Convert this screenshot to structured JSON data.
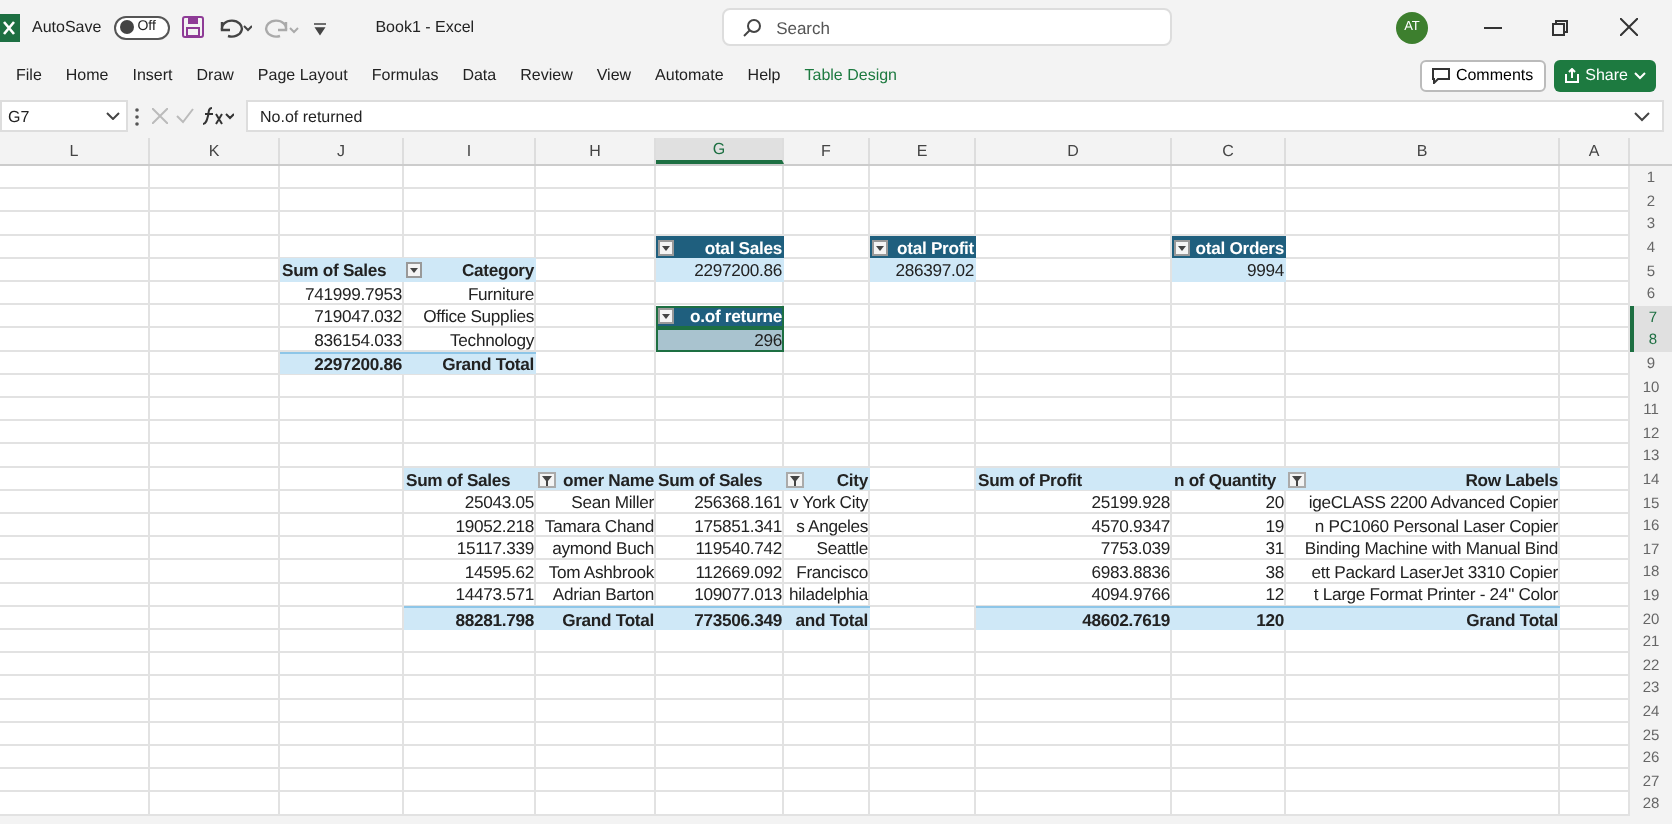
{
  "title_bar": {
    "autosave_label": "AutoSave",
    "autosave_state": "Off",
    "autosave_on": false,
    "document_title": "Book1 - Excel",
    "search": {
      "placeholder": "Search"
    },
    "avatar": "AT"
  },
  "ribbon_tabs": [
    {
      "label": "File",
      "kind": "normal"
    },
    {
      "label": "Home",
      "kind": "normal"
    },
    {
      "label": "Insert",
      "kind": "normal"
    },
    {
      "label": "Draw",
      "kind": "normal"
    },
    {
      "label": "Page Layout",
      "kind": "normal"
    },
    {
      "label": "Formulas",
      "kind": "normal"
    },
    {
      "label": "Data",
      "kind": "normal"
    },
    {
      "label": "Review",
      "kind": "normal"
    },
    {
      "label": "View",
      "kind": "normal"
    },
    {
      "label": "Automate",
      "kind": "normal"
    },
    {
      "label": "Help",
      "kind": "normal"
    },
    {
      "label": "Table Design",
      "kind": "contextual"
    }
  ],
  "ribbon_buttons": {
    "comments": "Comments",
    "share": "Share"
  },
  "formula_bar": {
    "name_box": "G7",
    "formula": "No.of returned"
  },
  "columns": [
    {
      "letter": "L",
      "selected": false
    },
    {
      "letter": "K",
      "selected": false
    },
    {
      "letter": "J",
      "selected": false
    },
    {
      "letter": "I",
      "selected": false
    },
    {
      "letter": "H",
      "selected": false
    },
    {
      "letter": "G",
      "selected": true
    },
    {
      "letter": "F",
      "selected": false
    },
    {
      "letter": "E",
      "selected": false
    },
    {
      "letter": "D",
      "selected": false
    },
    {
      "letter": "C",
      "selected": false
    },
    {
      "letter": "B",
      "selected": false
    },
    {
      "letter": "A",
      "selected": false
    }
  ],
  "rows": [
    {
      "number": "1",
      "selected": false
    },
    {
      "number": "2",
      "selected": false
    },
    {
      "number": "3",
      "selected": false
    },
    {
      "number": "4",
      "selected": false,
      "cells": [
        {
          "kind": "empty"
        },
        {
          "kind": "empty"
        },
        {
          "kind": "empty"
        },
        {
          "kind": "empty"
        },
        {
          "kind": "empty"
        },
        {
          "kind": "card-title",
          "text": "otal Sales",
          "filter": true,
          "sorted": false
        },
        {
          "kind": "empty"
        },
        {
          "kind": "card-title",
          "text": "otal Profit",
          "filter": true,
          "sorted": false
        },
        {
          "kind": "empty"
        },
        {
          "kind": "card-title",
          "text": "otal Orders",
          "filter": true,
          "sorted": false
        },
        {
          "kind": "empty"
        },
        {
          "kind": "empty"
        }
      ]
    },
    {
      "number": "5",
      "selected": false,
      "cells": [
        {
          "kind": "empty"
        },
        {
          "kind": "empty"
        },
        {
          "kind": "pivot-header",
          "text": "Sum of Sales"
        },
        {
          "kind": "pivot-header",
          "text": "Category",
          "filter": true,
          "sorted": false
        },
        {
          "kind": "empty"
        },
        {
          "kind": "card-value",
          "text": "2297200.86"
        },
        {
          "kind": "empty"
        },
        {
          "kind": "card-value",
          "text": "286397.02"
        },
        {
          "kind": "empty"
        },
        {
          "kind": "card-value",
          "text": "9994"
        },
        {
          "kind": "empty"
        },
        {
          "kind": "empty"
        }
      ]
    },
    {
      "number": "6",
      "selected": false,
      "cells": [
        {
          "kind": "empty"
        },
        {
          "kind": "empty"
        },
        {
          "kind": "value",
          "text": "741999.7953"
        },
        {
          "kind": "value",
          "text": "Furniture"
        },
        {
          "kind": "empty"
        },
        {
          "kind": "empty"
        },
        {
          "kind": "empty"
        },
        {
          "kind": "empty"
        },
        {
          "kind": "empty"
        },
        {
          "kind": "empty"
        },
        {
          "kind": "empty"
        },
        {
          "kind": "empty"
        }
      ]
    },
    {
      "number": "7",
      "selected": true,
      "cells": [
        {
          "kind": "empty"
        },
        {
          "kind": "empty"
        },
        {
          "kind": "value",
          "text": "719047.032"
        },
        {
          "kind": "value",
          "text": "Office Supplies"
        },
        {
          "kind": "empty"
        },
        {
          "kind": "card-title",
          "text": "o.of returne",
          "filter": true,
          "sorted": false
        },
        {
          "kind": "empty"
        },
        {
          "kind": "empty"
        },
        {
          "kind": "empty"
        },
        {
          "kind": "empty"
        },
        {
          "kind": "empty"
        },
        {
          "kind": "empty"
        }
      ]
    },
    {
      "number": "8",
      "selected": true,
      "cells": [
        {
          "kind": "empty"
        },
        {
          "kind": "empty"
        },
        {
          "kind": "value",
          "text": "836154.033"
        },
        {
          "kind": "value",
          "text": "Technology"
        },
        {
          "kind": "empty"
        },
        {
          "kind": "card-value",
          "text": "296"
        },
        {
          "kind": "empty"
        },
        {
          "kind": "empty"
        },
        {
          "kind": "empty"
        },
        {
          "kind": "empty"
        },
        {
          "kind": "empty"
        },
        {
          "kind": "empty"
        }
      ]
    },
    {
      "number": "9",
      "selected": false,
      "cells": [
        {
          "kind": "empty"
        },
        {
          "kind": "empty"
        },
        {
          "kind": "total",
          "text": "2297200.86"
        },
        {
          "kind": "total",
          "text": "Grand Total"
        },
        {
          "kind": "empty"
        },
        {
          "kind": "empty"
        },
        {
          "kind": "empty"
        },
        {
          "kind": "empty"
        },
        {
          "kind": "empty"
        },
        {
          "kind": "empty"
        },
        {
          "kind": "empty"
        },
        {
          "kind": "empty"
        }
      ]
    },
    {
      "number": "10",
      "selected": false
    },
    {
      "number": "11",
      "selected": false
    },
    {
      "number": "12",
      "selected": false
    },
    {
      "number": "13",
      "selected": false
    },
    {
      "number": "14",
      "selected": false,
      "cells": [
        {
          "kind": "empty"
        },
        {
          "kind": "empty"
        },
        {
          "kind": "empty"
        },
        {
          "kind": "pivot-header",
          "text": "Sum of Sales"
        },
        {
          "kind": "pivot-header",
          "text": "omer Name",
          "filter": true,
          "sorted": true
        },
        {
          "kind": "pivot-header",
          "text": "Sum of Sales"
        },
        {
          "kind": "pivot-header",
          "text": "City",
          "filter": true,
          "sorted": true
        },
        {
          "kind": "empty"
        },
        {
          "kind": "pivot-header",
          "text": "Sum of Profit"
        },
        {
          "kind": "pivot-header",
          "text": "n of Quantity"
        },
        {
          "kind": "pivot-header",
          "text": "Row Labels",
          "filter": true,
          "sorted": true
        },
        {
          "kind": "empty"
        }
      ]
    },
    {
      "number": "15",
      "selected": false,
      "cells": [
        {
          "kind": "empty"
        },
        {
          "kind": "empty"
        },
        {
          "kind": "empty"
        },
        {
          "kind": "value",
          "text": "25043.05"
        },
        {
          "kind": "value",
          "text": "Sean Miller"
        },
        {
          "kind": "value",
          "text": "256368.161"
        },
        {
          "kind": "value",
          "text": "v York City"
        },
        {
          "kind": "empty"
        },
        {
          "kind": "value",
          "text": "25199.928"
        },
        {
          "kind": "value",
          "text": "20"
        },
        {
          "kind": "value",
          "text": "igeCLASS 2200 Advanced Copier"
        },
        {
          "kind": "empty"
        }
      ]
    },
    {
      "number": "16",
      "selected": false,
      "cells": [
        {
          "kind": "empty"
        },
        {
          "kind": "empty"
        },
        {
          "kind": "empty"
        },
        {
          "kind": "value",
          "text": "19052.218"
        },
        {
          "kind": "value",
          "text": "Tamara Chand"
        },
        {
          "kind": "value",
          "text": "175851.341"
        },
        {
          "kind": "value",
          "text": "s Angeles"
        },
        {
          "kind": "empty"
        },
        {
          "kind": "value",
          "text": "4570.9347"
        },
        {
          "kind": "value",
          "text": "19"
        },
        {
          "kind": "value",
          "text": "n PC1060 Personal Laser Copier"
        },
        {
          "kind": "empty"
        }
      ]
    },
    {
      "number": "17",
      "selected": false,
      "cells": [
        {
          "kind": "empty"
        },
        {
          "kind": "empty"
        },
        {
          "kind": "empty"
        },
        {
          "kind": "value",
          "text": "15117.339"
        },
        {
          "kind": "value",
          "text": "aymond Buch"
        },
        {
          "kind": "value",
          "text": "119540.742"
        },
        {
          "kind": "value",
          "text": "Seattle"
        },
        {
          "kind": "empty"
        },
        {
          "kind": "value",
          "text": "7753.039"
        },
        {
          "kind": "value",
          "text": "31"
        },
        {
          "kind": "value",
          "text": "Binding Machine with Manual Bind"
        },
        {
          "kind": "empty"
        }
      ]
    },
    {
      "number": "18",
      "selected": false,
      "cells": [
        {
          "kind": "empty"
        },
        {
          "kind": "empty"
        },
        {
          "kind": "empty"
        },
        {
          "kind": "value",
          "text": "14595.62"
        },
        {
          "kind": "value",
          "text": "Tom Ashbrook"
        },
        {
          "kind": "value",
          "text": "112669.092"
        },
        {
          "kind": "value",
          "text": "Francisco"
        },
        {
          "kind": "empty"
        },
        {
          "kind": "value",
          "text": "6983.8836"
        },
        {
          "kind": "value",
          "text": "38"
        },
        {
          "kind": "value",
          "text": "ett Packard LaserJet 3310 Copier"
        },
        {
          "kind": "empty"
        }
      ]
    },
    {
      "number": "19",
      "selected": false,
      "cells": [
        {
          "kind": "empty"
        },
        {
          "kind": "empty"
        },
        {
          "kind": "empty"
        },
        {
          "kind": "value",
          "text": "14473.571"
        },
        {
          "kind": "value",
          "text": "Adrian Barton"
        },
        {
          "kind": "value",
          "text": "109077.013"
        },
        {
          "kind": "value",
          "text": "hiladelphia"
        },
        {
          "kind": "empty"
        },
        {
          "kind": "value",
          "text": "4094.9766"
        },
        {
          "kind": "value",
          "text": "12"
        },
        {
          "kind": "value",
          "text": "t Large Format Printer - 24\" Color"
        },
        {
          "kind": "empty"
        }
      ]
    },
    {
      "number": "20",
      "selected": false,
      "cells": [
        {
          "kind": "empty"
        },
        {
          "kind": "empty"
        },
        {
          "kind": "empty"
        },
        {
          "kind": "total",
          "text": "88281.798"
        },
        {
          "kind": "total",
          "text": "Grand Total"
        },
        {
          "kind": "total",
          "text": "773506.349"
        },
        {
          "kind": "total",
          "text": "and Total"
        },
        {
          "kind": "empty"
        },
        {
          "kind": "total",
          "text": "48602.7619"
        },
        {
          "kind": "total",
          "text": "120"
        },
        {
          "kind": "total",
          "text": "Grand Total"
        },
        {
          "kind": "empty"
        }
      ]
    },
    {
      "number": "21",
      "selected": false
    },
    {
      "number": "22",
      "selected": false
    },
    {
      "number": "23",
      "selected": false
    },
    {
      "number": "24",
      "selected": false
    },
    {
      "number": "25",
      "selected": false
    },
    {
      "number": "26",
      "selected": false
    },
    {
      "number": "27",
      "selected": false
    },
    {
      "number": "28",
      "selected": false
    }
  ]
}
